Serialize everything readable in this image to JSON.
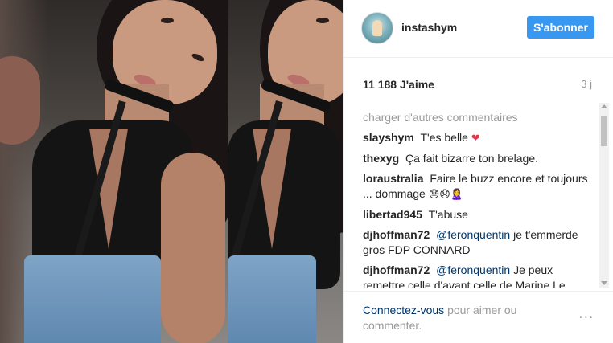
{
  "post": {
    "username": "instashym",
    "follow_label": "S'abonner",
    "likes": "11 188 J'aime",
    "age": "3 j",
    "load_more": "charger d'autres commentaires",
    "comments": [
      {
        "user": "slayshym",
        "text": "T'es belle",
        "emoji": "❤"
      },
      {
        "user": "thexyg",
        "text": "Ça fait bizarre ton brelage.",
        "emoji": ""
      },
      {
        "user": "loraustralia",
        "text": "Faire le buzz encore et toujours ... dommage",
        "emoji": "😓😞🙎‍♀️"
      },
      {
        "user": "libertad945",
        "text": "T'abuse",
        "emoji": ""
      },
      {
        "user": "djhoffman72",
        "mention": "@feronquentin",
        "text": "je t'emmerde gros FDP CONNARD",
        "emoji": ""
      },
      {
        "user": "djhoffman72",
        "mention": "@feronquentin",
        "text": "Je peux remettre celle d'avant celle de Marine Le",
        "emoji": ""
      }
    ],
    "footer": {
      "login_link": "Connectez-vous",
      "login_text": "pour aimer ou commenter.",
      "more_icon": "..."
    }
  },
  "colors": {
    "accent": "#3897f0",
    "link": "#003569",
    "muted": "#999999"
  }
}
